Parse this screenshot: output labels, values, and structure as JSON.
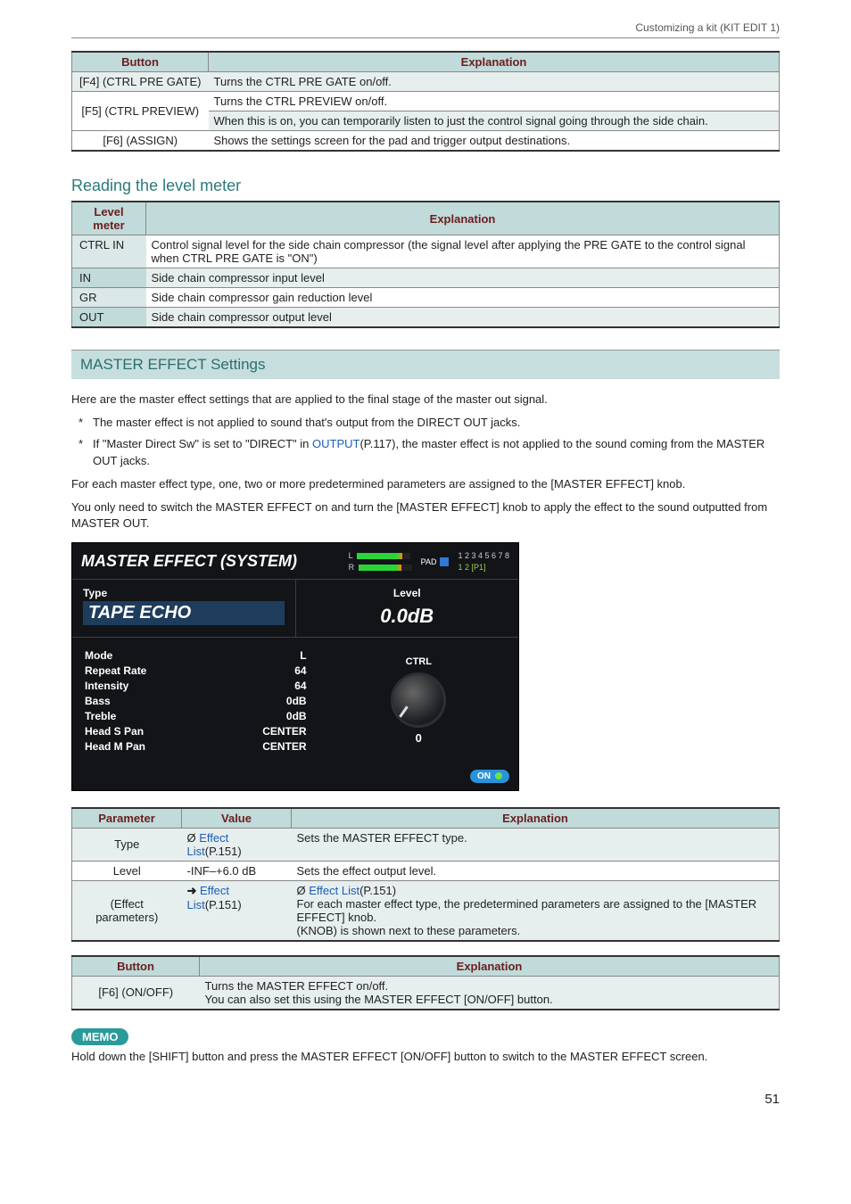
{
  "breadcrumb": "Customizing a kit (KIT EDIT 1)",
  "table1": {
    "headers": [
      "Button",
      "Explanation"
    ],
    "rows": [
      {
        "c1": "[F4] (CTRL PRE GATE)",
        "c2": "Turns the CTRL PRE GATE on/off."
      },
      {
        "c1": "[F5] (CTRL PREVIEW)",
        "c2a": "Turns the CTRL PREVIEW on/off.",
        "c2b": "When this is on, you can temporarily listen to just the control signal going through the side chain."
      },
      {
        "c1": "[F6] (ASSIGN)",
        "c2": "Shows the settings screen for the pad and trigger output destinations."
      }
    ]
  },
  "levelmeter": {
    "heading": "Reading the level meter",
    "headers": [
      "Level meter",
      "Explanation"
    ],
    "rows": [
      {
        "c1": "CTRL IN",
        "c2": "Control signal level for the side chain compressor (the signal level after applying the PRE GATE to the control signal when CTRL PRE GATE is \"ON\")"
      },
      {
        "c1": "IN",
        "c2": "Side chain compressor input level"
      },
      {
        "c1": "GR",
        "c2": "Side chain compressor gain reduction level"
      },
      {
        "c1": "OUT",
        "c2": "Side chain compressor output level"
      }
    ]
  },
  "master": {
    "heading": "MASTER EFFECT Settings",
    "intro": "Here are the master effect settings that are applied to the final stage of the master out signal.",
    "bullet1": "The master effect is not applied to sound that's output from the DIRECT OUT jacks.",
    "bullet2_pre": "If \"Master Direct Sw\" is set to \"DIRECT\" in ",
    "bullet2_link": "OUTPUT",
    "bullet2_post": "(P.117), the master effect is not applied to the sound coming from the MASTER OUT jacks.",
    "p2": "For each master effect type, one, two or more predetermined parameters are assigned to the [MASTER EFFECT] knob.",
    "p3": "You only need to switch the MASTER EFFECT on and turn the [MASTER EFFECT] knob to apply the effect to the sound outputted from MASTER OUT."
  },
  "screenshot": {
    "title": "MASTER EFFECT (SYSTEM)",
    "meter_L": "L",
    "meter_R": "R",
    "pad": "PAD",
    "nums1": "1 2 3 4 5 6 7 8",
    "nums2": "1 2 [P1]",
    "type_label": "Type",
    "type_value": "TAPE ECHO",
    "level_label": "Level",
    "level_value": "0.0dB",
    "params": [
      {
        "name": "Mode",
        "value": "L"
      },
      {
        "name": "Repeat Rate",
        "value": "64"
      },
      {
        "name": "Intensity",
        "value": "64"
      },
      {
        "name": "Bass",
        "value": "0dB"
      },
      {
        "name": "Treble",
        "value": "0dB"
      },
      {
        "name": "Head S Pan",
        "value": "CENTER"
      },
      {
        "name": "Head M Pan",
        "value": "CENTER"
      }
    ],
    "knob_label": "CTRL",
    "knob_value": "0",
    "on": "ON"
  },
  "paramtable": {
    "headers": [
      "Parameter",
      "Value",
      "Explanation"
    ],
    "rows": {
      "r1": {
        "c1": "Type",
        "c2_pre": "Ø ",
        "c2_link": "Effect List",
        "c2_post": "(P.151)",
        "c3": "Sets the MASTER EFFECT type."
      },
      "r2": {
        "c1": "Level",
        "c2": "-INF–+6.0 dB",
        "c3": "Sets the effect output level."
      },
      "r3": {
        "c1": "(Effect parameters)",
        "c2_arrow": "➜ ",
        "c2_link": "Effect List",
        "c2_post": "(P.151)",
        "c3a_pre": "Ø ",
        "c3a_link": "Effect List",
        "c3a_post": "(P.151)",
        "c3b": "For each master effect type, the predetermined parameters are assigned to the [MASTER EFFECT] knob.",
        "c3c": "(KNOB) is shown next to these parameters."
      }
    }
  },
  "btntable": {
    "headers": [
      "Button",
      "Explanation"
    ],
    "row": {
      "c1": "[F6] (ON/OFF)",
      "c2a": "Turns the MASTER EFFECT on/off.",
      "c2b": "You can also set this using the MASTER EFFECT [ON/OFF] button."
    }
  },
  "memo": {
    "label": "MEMO",
    "text": "Hold down the [SHIFT] button and press the MASTER EFFECT [ON/OFF] button to switch to the MASTER EFFECT screen."
  },
  "page_number": "51"
}
